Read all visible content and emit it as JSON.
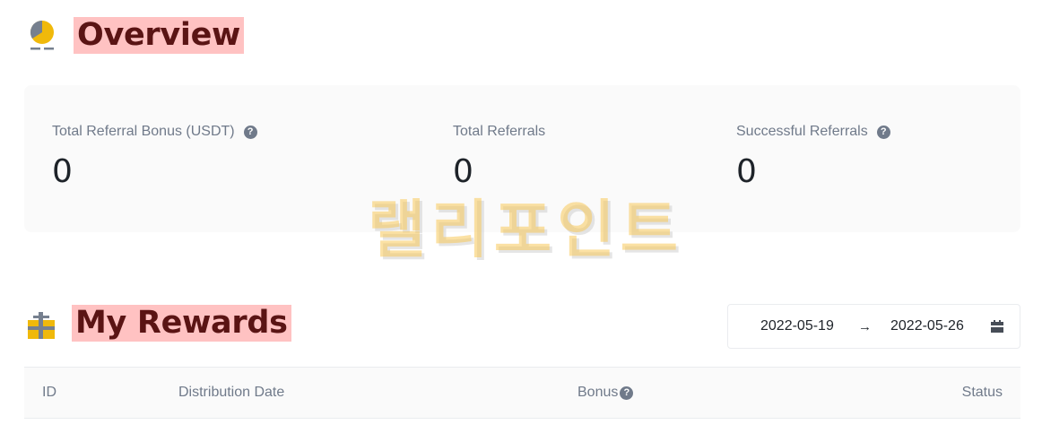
{
  "overview": {
    "title": "Overview",
    "icon": "pie-chart-icon",
    "stats": [
      {
        "label": "Total Referral Bonus (USDT)",
        "value": "0",
        "help": true
      },
      {
        "label": "Total Referrals",
        "value": "0",
        "help": false
      },
      {
        "label": "Successful Referrals",
        "value": "0",
        "help": true
      }
    ]
  },
  "watermark": {
    "text": "랠리포인트"
  },
  "rewards": {
    "title": "My Rewards",
    "icon": "gift-icon",
    "date_start": "2022-05-19",
    "date_arrow": "→",
    "date_end": "2022-05-26",
    "columns": [
      "ID",
      "Distribution Date",
      "Bonus",
      "Status"
    ]
  },
  "colors": {
    "accent": "#f0b90b",
    "title": "#5a1414",
    "title_bg": "#ffc2c2",
    "muted": "#707a8a"
  }
}
